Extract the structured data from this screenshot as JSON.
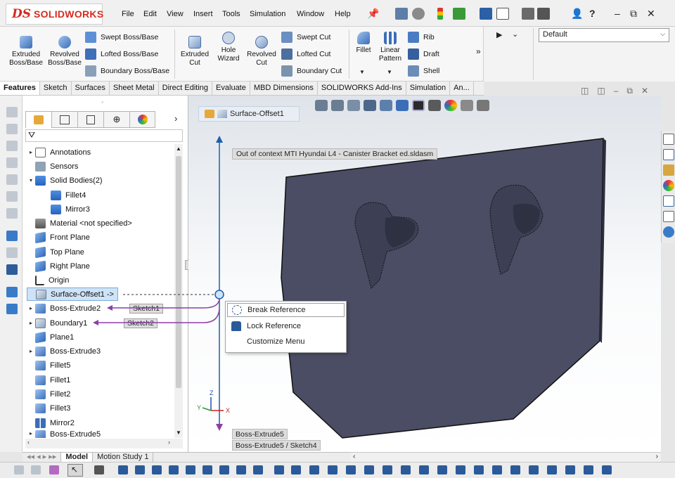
{
  "app": {
    "logo_mark": "DS",
    "logo_text": "SOLIDWORKS"
  },
  "menu": [
    "File",
    "Edit",
    "View",
    "Insert",
    "Tools",
    "Simulation",
    "Window",
    "Help"
  ],
  "ribbon": {
    "extruded_boss": "Extruded Boss/Base",
    "revolved_boss": "Revolved Boss/Base",
    "swept_boss": "Swept Boss/Base",
    "lofted_boss": "Lofted Boss/Base",
    "boundary_boss": "Boundary Boss/Base",
    "extruded_cut": "Extruded Cut",
    "hole_wizard": "Hole Wizard",
    "revolved_cut": "Revolved Cut",
    "swept_cut": "Swept Cut",
    "lofted_cut": "Lofted Cut",
    "boundary_cut": "Boundary Cut",
    "fillet": "Fillet",
    "linear_pattern": "Linear Pattern",
    "rib": "Rib",
    "draft": "Draft",
    "shell": "Shell"
  },
  "configuration": "Default",
  "tabs": [
    "Features",
    "Sketch",
    "Surfaces",
    "Sheet Metal",
    "Direct Editing",
    "Evaluate",
    "MBD Dimensions",
    "SOLIDWORKS Add-Ins",
    "Simulation",
    "An..."
  ],
  "tree": [
    {
      "label": "Annotations",
      "icon": "annotations-icon",
      "expander": "▸"
    },
    {
      "label": "Sensors",
      "icon": "sensors-icon",
      "expander": ""
    },
    {
      "label": "Solid Bodies(2)",
      "icon": "solid-bodies-icon",
      "expander": "▾"
    },
    {
      "label": "Fillet4",
      "icon": "body-icon",
      "expander": ""
    },
    {
      "label": "Mirror3",
      "icon": "body-icon",
      "expander": ""
    },
    {
      "label": "Material <not specified>",
      "icon": "material-icon",
      "expander": ""
    },
    {
      "label": "Front Plane",
      "icon": "plane-icon",
      "expander": ""
    },
    {
      "label": "Top Plane",
      "icon": "plane-icon",
      "expander": ""
    },
    {
      "label": "Right Plane",
      "icon": "plane-icon",
      "expander": ""
    },
    {
      "label": "Origin",
      "icon": "origin-icon",
      "expander": ""
    },
    {
      "label": "Surface-Offset1 ->",
      "icon": "surface-offset-icon",
      "expander": ""
    },
    {
      "label": "Boss-Extrude2",
      "icon": "feature-icon",
      "expander": "▸"
    },
    {
      "label": "Boundary1",
      "icon": "boundary-icon",
      "expander": "▸"
    },
    {
      "label": "Plane1",
      "icon": "plane-icon",
      "expander": ""
    },
    {
      "label": "Boss-Extrude3",
      "icon": "feature-icon",
      "expander": "▸"
    },
    {
      "label": "Fillet5",
      "icon": "feature-icon",
      "expander": ""
    },
    {
      "label": "Fillet1",
      "icon": "feature-icon",
      "expander": ""
    },
    {
      "label": "Fillet2",
      "icon": "feature-icon",
      "expander": ""
    },
    {
      "label": "Fillet3",
      "icon": "feature-icon",
      "expander": ""
    },
    {
      "label": "Mirror2",
      "icon": "mirror-icon",
      "expander": ""
    },
    {
      "label": "Boss-Extrude5",
      "icon": "feature-icon",
      "expander": "▸"
    }
  ],
  "reference_labels": {
    "sketch1": "Sketch1",
    "sketch2": "Sketch2"
  },
  "breadcrumb": "Surface-Offset1",
  "context_label": "Out of context MTI Hyundai L4 - Canister Bracket ed.sldasm",
  "context_menu": [
    "Break Reference",
    "Lock Reference",
    "Customize Menu"
  ],
  "status": {
    "line1": "Boss-Extrude5",
    "line2": "Boss-Extrude5 / Sketch4"
  },
  "bottom_tabs": [
    "Model",
    "Motion Study 1"
  ],
  "triad": {
    "x": "X",
    "y": "Y",
    "z": "Z"
  },
  "colors": {
    "accent": "#d52b1e",
    "selection": "#cfe3f7",
    "model": "#4a4d63"
  }
}
